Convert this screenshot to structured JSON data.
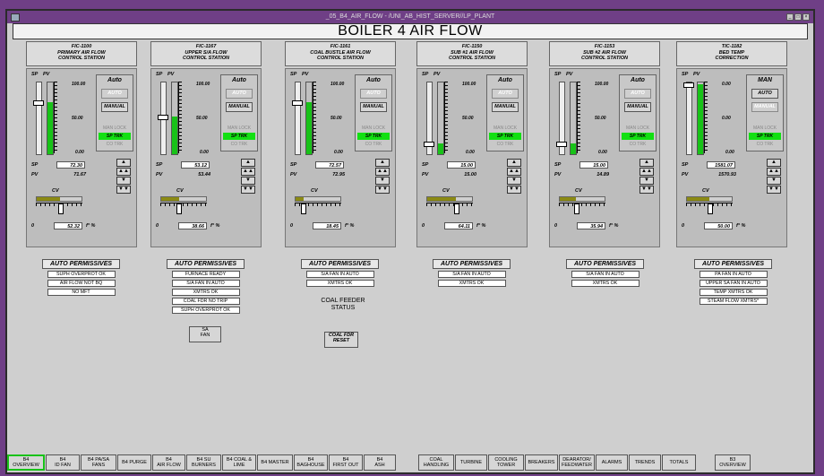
{
  "window": {
    "path": "_05_B4_AIR_FLOW - /UNI_AB_HIST_SERVER//LP_PLANT",
    "title": "BOILER 4 AIR FLOW"
  },
  "labels": {
    "sp": "SP",
    "pv": "PV",
    "cv": "CV",
    "auto": "AUTO",
    "manual": "MANUAL",
    "man_lock": "MAN LOCK",
    "sp_trk": "SP TRK",
    "co_trk": "CO TRK",
    "cv_zero": "0",
    "cv_units": "f° %",
    "up": "▲",
    "up2": "▲▲",
    "down": "▼",
    "down2": "▼▼"
  },
  "stations": [
    {
      "tag": "FIC-1100",
      "name1": "PRIMARY AIR FLOW",
      "name2": "CONTROL STATION",
      "mode": "Auto",
      "scale_top": "100.00",
      "scale_mid": "50.00",
      "scale_bot": "0.00",
      "sp": "72.30",
      "pv": "71.67",
      "cv": "52.32",
      "sp_level": 0.72,
      "pv_level": 0.72,
      "cv_level": 0.52,
      "auto_active": false
    },
    {
      "tag": "FIC-1167",
      "name1": "UPPER S/A FLOW",
      "name2": "CONTROL STATION",
      "mode": "Auto",
      "scale_top": "100.00",
      "scale_mid": "50.00",
      "scale_bot": "0.00",
      "sp": "53.12",
      "pv": "53.44",
      "cv": "38.66",
      "sp_level": 0.53,
      "pv_level": 0.53,
      "cv_level": 0.39,
      "auto_active": false
    },
    {
      "tag": "FIC-1161",
      "name1": "COAL BUSTLE AIR FLOW",
      "name2": "CONTROL STATION",
      "mode": "Auto",
      "scale_top": "100.00",
      "scale_mid": "50.00",
      "scale_bot": "0.00",
      "sp": "72.57",
      "pv": "72.95",
      "cv": "18.45",
      "sp_level": 0.73,
      "pv_level": 0.73,
      "cv_level": 0.18,
      "auto_active": false
    },
    {
      "tag": "FIC-1150",
      "name1": "SUB #1 AIR FLOW",
      "name2": "CONTROL STATION",
      "mode": "Auto",
      "scale_top": "100.00",
      "scale_mid": "50.00",
      "scale_bot": "0.00",
      "sp": "15.00",
      "pv": "15.00",
      "cv": "64.11",
      "sp_level": 0.15,
      "pv_level": 0.15,
      "cv_level": 0.64,
      "auto_active": false
    },
    {
      "tag": "FIC-1153",
      "name1": "SUB #2 AIR FLOW",
      "name2": "CONTROL STATION",
      "mode": "Auto",
      "scale_top": "100.00",
      "scale_mid": "50.00",
      "scale_bot": "0.00",
      "sp": "15.00",
      "pv": "14.89",
      "cv": "35.94",
      "sp_level": 0.15,
      "pv_level": 0.15,
      "cv_level": 0.36,
      "auto_active": false
    },
    {
      "tag": "TIC-1182",
      "name1": "BED TEMP",
      "name2": "CORRECTION",
      "mode": "MAN",
      "scale_top": "0.00",
      "scale_mid": "0.00",
      "scale_bot": "0.00",
      "sp": "1581.07",
      "pv": "1570.93",
      "cv": "50.00",
      "sp_level": 0.98,
      "pv_level": 0.98,
      "cv_level": 0.5,
      "auto_active": true
    }
  ],
  "permissives": {
    "title": "AUTO PERMISSIVES",
    "groups": [
      [
        "SUPH OVERPROT OK",
        "AIR FLOW NOT BQ",
        "NO MFT"
      ],
      [
        "FURNACE READY",
        "S/A FAN IN AUTO",
        "XMTRS OK",
        "COAL FDR NO TRIP",
        "SUPH OVERPROT OK"
      ],
      [
        "S/A FAN IN AUTO",
        "XMTRS OK"
      ],
      [
        "S/A FAN IN AUTO",
        "XMTRS OK"
      ],
      [
        "S/A FAN IN AUTO",
        "XMTRS OK"
      ],
      [
        "PA FAN IN AUTO",
        "UPPER SA FAN IN AUTO",
        "TEMP XMTRS OK",
        "STEAM FLOW XMTRS*"
      ]
    ]
  },
  "extras": {
    "sa_fan_1": "SA",
    "sa_fan_2": "FAN",
    "coal_feeder_status_1": "COAL FEEDER",
    "coal_feeder_status_2": "STATUS",
    "coal_fdr_reset_1": "COAL FDR",
    "coal_fdr_reset_2": "RESET"
  },
  "nav": [
    {
      "l1": "B4",
      "l2": "OVERVIEW",
      "active": true
    },
    {
      "l1": "B4",
      "l2": "ID FAN"
    },
    {
      "l1": "B4 PA/SA",
      "l2": "FANS"
    },
    {
      "l1": "B4 PURGE",
      "l2": ""
    },
    {
      "l1": "B4",
      "l2": "AIR FLOW"
    },
    {
      "l1": "B4 SU",
      "l2": "BURNERS"
    },
    {
      "l1": "B4 COAL &",
      "l2": "LIME"
    },
    {
      "l1": "B4 MASTER",
      "l2": ""
    },
    {
      "l1": "B4",
      "l2": "BAGHOUSE"
    },
    {
      "l1": "B4",
      "l2": "FIRST OUT"
    },
    {
      "l1": "B4",
      "l2": "ASH"
    },
    {
      "l1": "COAL",
      "l2": "HANDLING"
    },
    {
      "l1": "TURBINE",
      "l2": ""
    },
    {
      "l1": "COOLING",
      "l2": "TOWER"
    },
    {
      "l1": "BREAKERS",
      "l2": ""
    },
    {
      "l1": "DEARATOR/",
      "l2": "FEEDWATER"
    },
    {
      "l1": "ALARMS",
      "l2": ""
    },
    {
      "l1": "TRENDS",
      "l2": ""
    },
    {
      "l1": "TOTALS",
      "l2": ""
    },
    {
      "l1": "B3",
      "l2": "OVERVIEW"
    }
  ]
}
